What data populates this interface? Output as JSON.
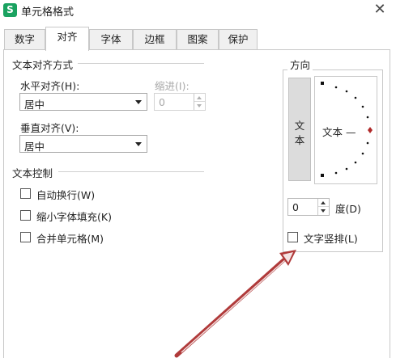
{
  "window": {
    "app_icon": "S",
    "title": "单元格格式",
    "close_glyph": "✕"
  },
  "tabs": [
    {
      "label": "数字",
      "active": false
    },
    {
      "label": "对齐",
      "active": true
    },
    {
      "label": "字体",
      "active": false
    },
    {
      "label": "边框",
      "active": false
    },
    {
      "label": "图案",
      "active": false
    },
    {
      "label": "保护",
      "active": false
    }
  ],
  "alignment": {
    "section_title": "文本对齐方式",
    "horizontal_label": "水平对齐(H):",
    "horizontal_value": "居中",
    "indent_label": "缩进(I):",
    "indent_value": "0",
    "vertical_label": "垂直对齐(V):",
    "vertical_value": "居中"
  },
  "text_control": {
    "section_title": "文本控制",
    "options": [
      {
        "label": "自动换行(W)",
        "checked": false
      },
      {
        "label": "缩小字体填充(K)",
        "checked": false
      },
      {
        "label": "合并单元格(M)",
        "checked": false
      }
    ]
  },
  "orientation": {
    "section_title": "方向",
    "vertical_text": [
      "文",
      "本"
    ],
    "dial_text": "文本 —",
    "degrees_value": "0",
    "degrees_label": "度(D)",
    "vertical_checkbox_label": "文字竖排(L)",
    "vertical_checkbox_checked": false,
    "indicator_color": "#b02a2a"
  },
  "annotation": {
    "arrow_color": "#b03a3a",
    "arrow_icon": "arrow-annotation-icon"
  }
}
